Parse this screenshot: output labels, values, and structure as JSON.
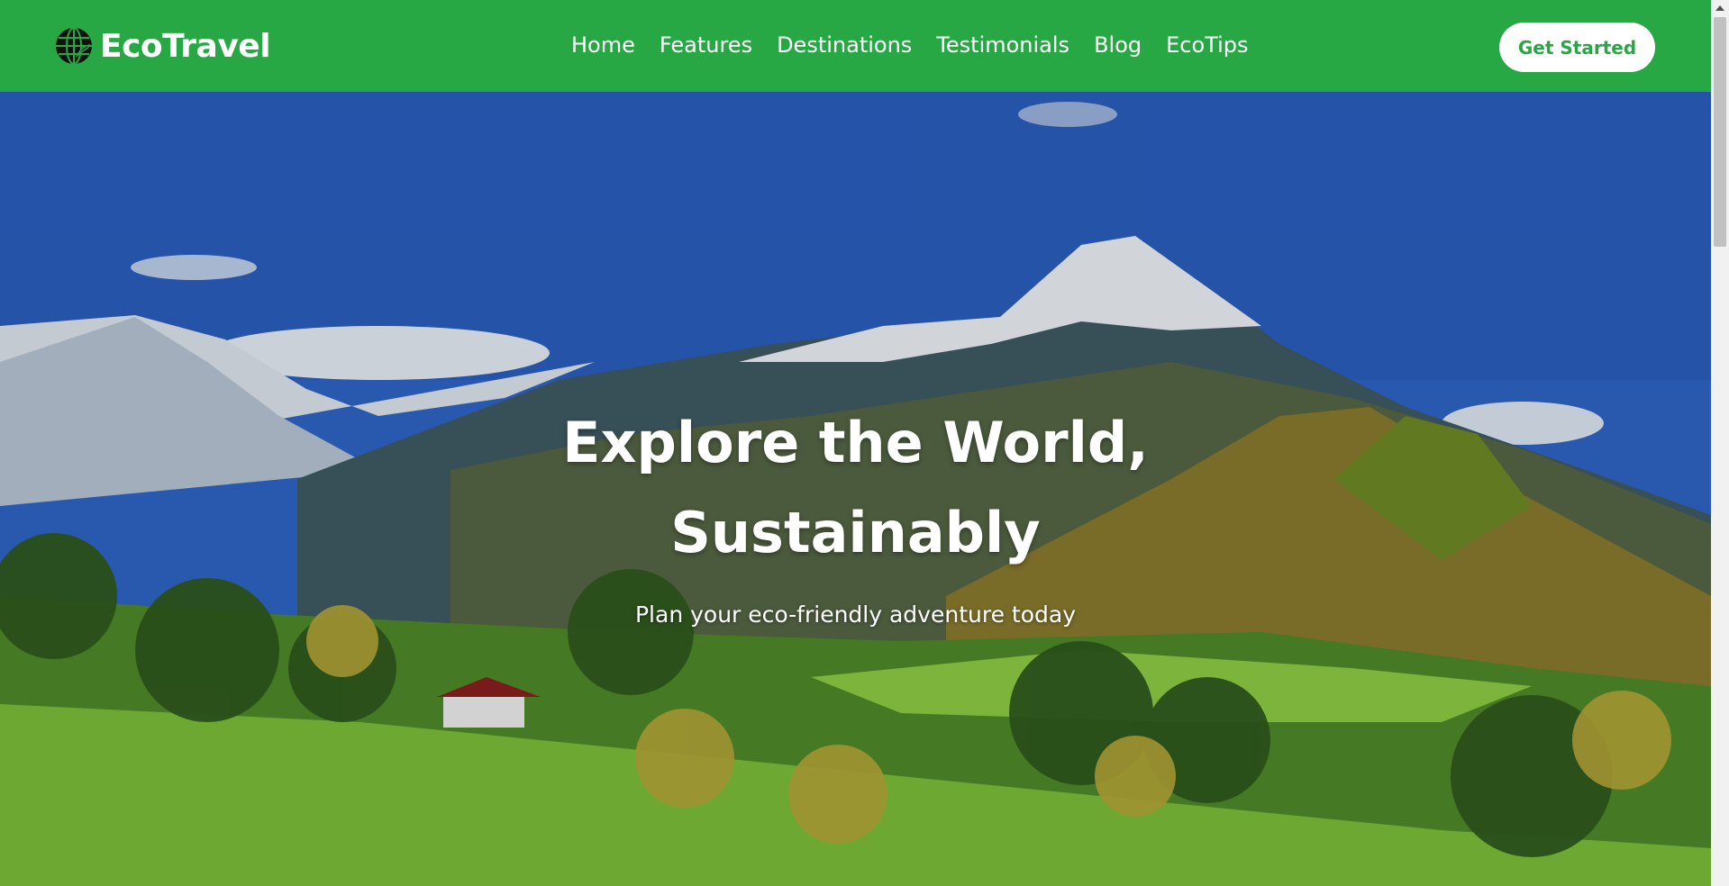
{
  "brand": {
    "name": "EcoTravel",
    "icon": "globe-icon"
  },
  "nav": {
    "items": [
      "Home",
      "Features",
      "Destinations",
      "Testimonials",
      "Blog",
      "EcoTips"
    ]
  },
  "cta": {
    "label": "Get Started"
  },
  "hero": {
    "title_line1": "Explore the World,",
    "title_line2": "Sustainably",
    "subtitle": "Plan your eco-friendly adventure today"
  },
  "colors": {
    "brand_green": "#28a745",
    "white": "#ffffff"
  }
}
